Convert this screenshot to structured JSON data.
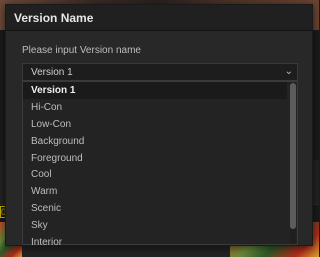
{
  "dialog": {
    "title": "Version Name",
    "prompt": "Please input Version name",
    "selected_value": "Version 1"
  },
  "dropdown": {
    "items": [
      "Version 1",
      "Hi-Con",
      "Low-Con",
      "Background",
      "Foreground",
      "Cool",
      "Warm",
      "Scenic",
      "Sky",
      "Interior"
    ]
  },
  "background": {
    "badge_text": "02"
  }
}
